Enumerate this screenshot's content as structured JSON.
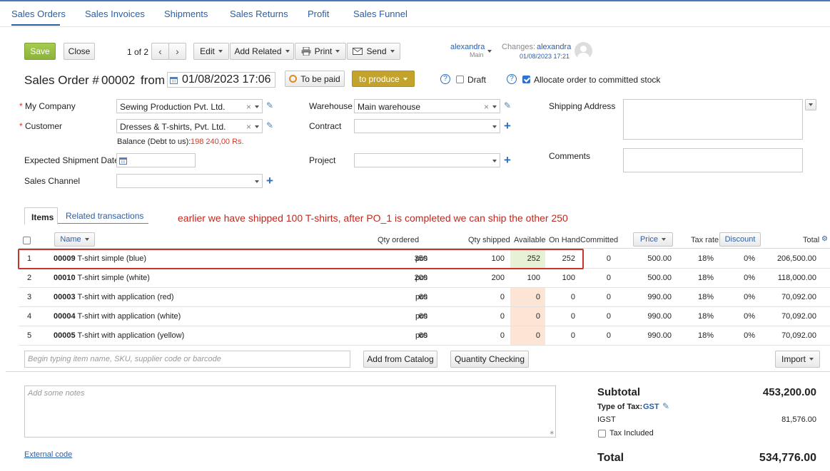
{
  "nav": {
    "tabs": [
      "Sales Orders",
      "Sales Invoices",
      "Shipments",
      "Sales Returns",
      "Profit",
      "Sales Funnel"
    ]
  },
  "toolbar": {
    "save": "Save",
    "close": "Close",
    "pager": "1 of 2",
    "edit": "Edit",
    "add_related": "Add Related",
    "print": "Print",
    "send": "Send"
  },
  "owner": {
    "name": "alexandra",
    "sub": "Main"
  },
  "changes": {
    "label": "Changes:",
    "name": "alexandra",
    "date": "01/08/2023 17:21"
  },
  "order": {
    "title": "Sales Order #",
    "number": "00002",
    "from": "from",
    "datetime": "01/08/2023 17:06",
    "to_be_paid": "To be paid",
    "status": "to produce",
    "draft": "Draft",
    "allocate": "Allocate order to committed stock"
  },
  "form": {
    "my_company_label": "My Company",
    "my_company": "Sewing Production Pvt. Ltd.",
    "customer_label": "Customer",
    "customer": "Dresses & T-shirts, Pvt. Ltd.",
    "balance_label": "Balance (Debt to us):",
    "balance": "198 240,00 Rs.",
    "expected_label": "Expected Shipment Date",
    "channel_label": "Sales Channel",
    "warehouse_label": "Warehouse",
    "warehouse": "Main warehouse",
    "contract_label": "Contract",
    "project_label": "Project",
    "shipping_label": "Shipping Address",
    "comments_label": "Comments"
  },
  "tabs2": {
    "items": "Items",
    "related": "Related transactions"
  },
  "annotation": "earlier we have shipped 100 T-shirts, after PO_1 is completed we can ship the other 250",
  "columns": {
    "name": "Name",
    "qty_ordered": "Qty ordered",
    "qty_shipped": "Qty shipped",
    "available": "Available",
    "on_hand": "On Hand",
    "committed": "Committed",
    "price": "Price",
    "tax_rate": "Tax rate",
    "discount": "Discount",
    "total": "Total"
  },
  "rows": [
    {
      "n": "1",
      "sku": "00009",
      "name": "T-shirt simple (blue)",
      "qty": "350",
      "unit": "pcs",
      "shipped": "100",
      "available": "252",
      "on_hand": "252",
      "committed": "0",
      "price": "500.00",
      "tax": "18%",
      "discount": "0%",
      "total": "206,500.00"
    },
    {
      "n": "2",
      "sku": "00010",
      "name": "T-shirt simple (white)",
      "qty": "200",
      "unit": "pcs",
      "shipped": "200",
      "available": "100",
      "on_hand": "100",
      "committed": "0",
      "price": "500.00",
      "tax": "18%",
      "discount": "0%",
      "total": "118,000.00"
    },
    {
      "n": "3",
      "sku": "00003",
      "name": "T-shirt with application (red)",
      "qty": "60",
      "unit": "pcs",
      "shipped": "0",
      "available": "0",
      "on_hand": "0",
      "committed": "0",
      "price": "990.00",
      "tax": "18%",
      "discount": "0%",
      "total": "70,092.00"
    },
    {
      "n": "4",
      "sku": "00004",
      "name": "T-shirt with application (white)",
      "qty": "60",
      "unit": "pcs",
      "shipped": "0",
      "available": "0",
      "on_hand": "0",
      "committed": "0",
      "price": "990.00",
      "tax": "18%",
      "discount": "0%",
      "total": "70,092.00"
    },
    {
      "n": "5",
      "sku": "00005",
      "name": "T-shirt with application (yellow)",
      "qty": "60",
      "unit": "pcs",
      "shipped": "0",
      "available": "0",
      "on_hand": "0",
      "committed": "0",
      "price": "990.00",
      "tax": "18%",
      "discount": "0%",
      "total": "70,092.00"
    }
  ],
  "search": {
    "placeholder": "Begin typing item name, SKU, supplier code or barcode"
  },
  "actions": {
    "add_from_catalog": "Add from Catalog",
    "quantity_checking": "Quantity Checking",
    "import": "Import"
  },
  "notes": {
    "placeholder": "Add some notes"
  },
  "external_code": "External code",
  "totals": {
    "subtotal_label": "Subtotal",
    "subtotal": "453,200.00",
    "tax_type_label": "Type of Tax:",
    "tax_type": "GST",
    "igst_label": "IGST",
    "igst": "81,576.00",
    "tax_included": "Tax Included",
    "total_label": "Total",
    "total": "534,776.00"
  },
  "colors": {
    "accent": "#2a5fa8",
    "save": "#93bb40",
    "status": "#c3a32c",
    "annotation": "#c0281e"
  }
}
